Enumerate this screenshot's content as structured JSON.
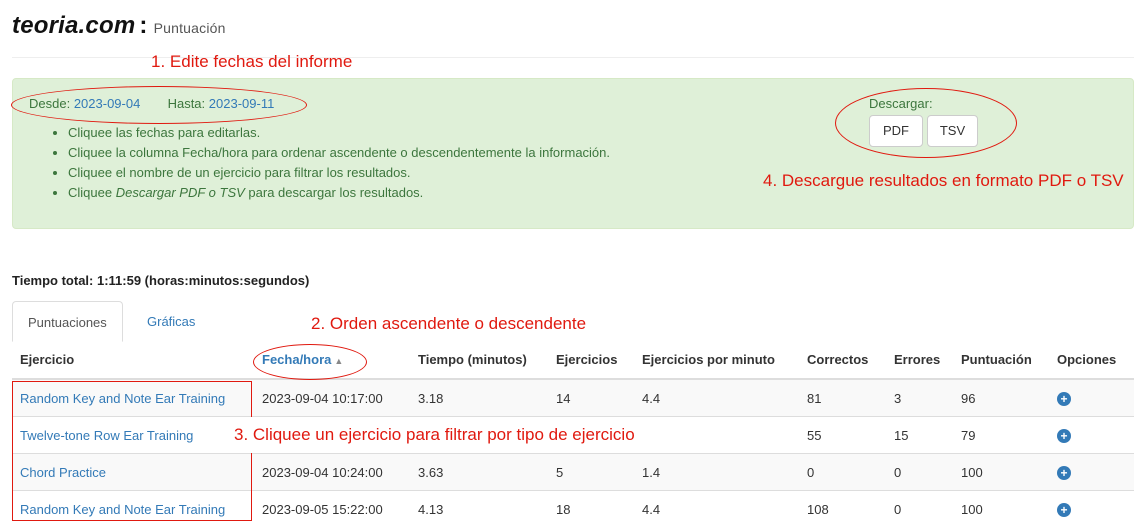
{
  "header": {
    "site": "teoria.com",
    "separator": ":",
    "section": "Puntuación"
  },
  "annotations": {
    "edit_dates": "1. Edite fechas del informe",
    "sort": "2. Orden ascendente o descendente",
    "filter": "3. Cliquee un ejercicio para filtrar por tipo de ejercicio",
    "download": "4. Descargue resultados en formato PDF o TSV"
  },
  "filters": {
    "from_label": "Desde:",
    "from_value": "2023-09-04",
    "to_label": "Hasta:",
    "to_value": "2023-09-11"
  },
  "tips": {
    "tip1": "Cliquee las fechas para editarlas.",
    "tip2": "Cliquee la columna Fecha/hora para ordenar ascendente o descendentemente la información.",
    "tip3": "Cliquee el nombre de un ejercicio para filtrar los resultados.",
    "tip4_before": "Cliquee ",
    "tip4_emph": "Descargar PDF o TSV",
    "tip4_after": " para descargar los resultados."
  },
  "download": {
    "label": "Descargar:",
    "pdf": "PDF",
    "tsv": "TSV"
  },
  "total_time": "Tiempo total: 1:11:59 (horas:minutos:segundos)",
  "tabs": {
    "scores": "Puntuaciones",
    "charts": "Gráficas"
  },
  "table": {
    "headers": {
      "exercise": "Ejercicio",
      "datetime": "Fecha/hora",
      "time": "Tiempo (minutos)",
      "exercises": "Ejercicios",
      "per_minute": "Ejercicios por minuto",
      "correct": "Correctos",
      "errors": "Errores",
      "score": "Puntuación",
      "options": "Opciones"
    },
    "sort_indicator": "▲",
    "rows": [
      {
        "exercise": "Random Key and Note Ear Training",
        "datetime": "2023-09-04 10:17:00",
        "time": "3.18",
        "exercises": "14",
        "per_minute": "4.4",
        "correct": "81",
        "errors": "3",
        "score": "96",
        "option": "+"
      },
      {
        "exercise": "Twelve-tone Row Ear Training",
        "datetime": "",
        "time": "",
        "exercises": "",
        "per_minute": "",
        "correct": "55",
        "errors": "15",
        "score": "79",
        "option": "+"
      },
      {
        "exercise": "Chord Practice",
        "datetime": "2023-09-04 10:24:00",
        "time": "3.63",
        "exercises": "5",
        "per_minute": "1.4",
        "correct": "0",
        "errors": "0",
        "score": "100",
        "option": "+"
      },
      {
        "exercise": "Random Key and Note Ear Training",
        "datetime": "2023-09-05 15:22:00",
        "time": "4.13",
        "exercises": "18",
        "per_minute": "4.4",
        "correct": "108",
        "errors": "0",
        "score": "100",
        "option": "+"
      }
    ]
  },
  "colors": {
    "annotation": "#e0190f",
    "link": "#337ab7",
    "panel_bg": "#dff0d8",
    "panel_text": "#3c763d"
  },
  "icons": {
    "option": "plus-circle-icon",
    "sort": "sort-asc-icon"
  }
}
